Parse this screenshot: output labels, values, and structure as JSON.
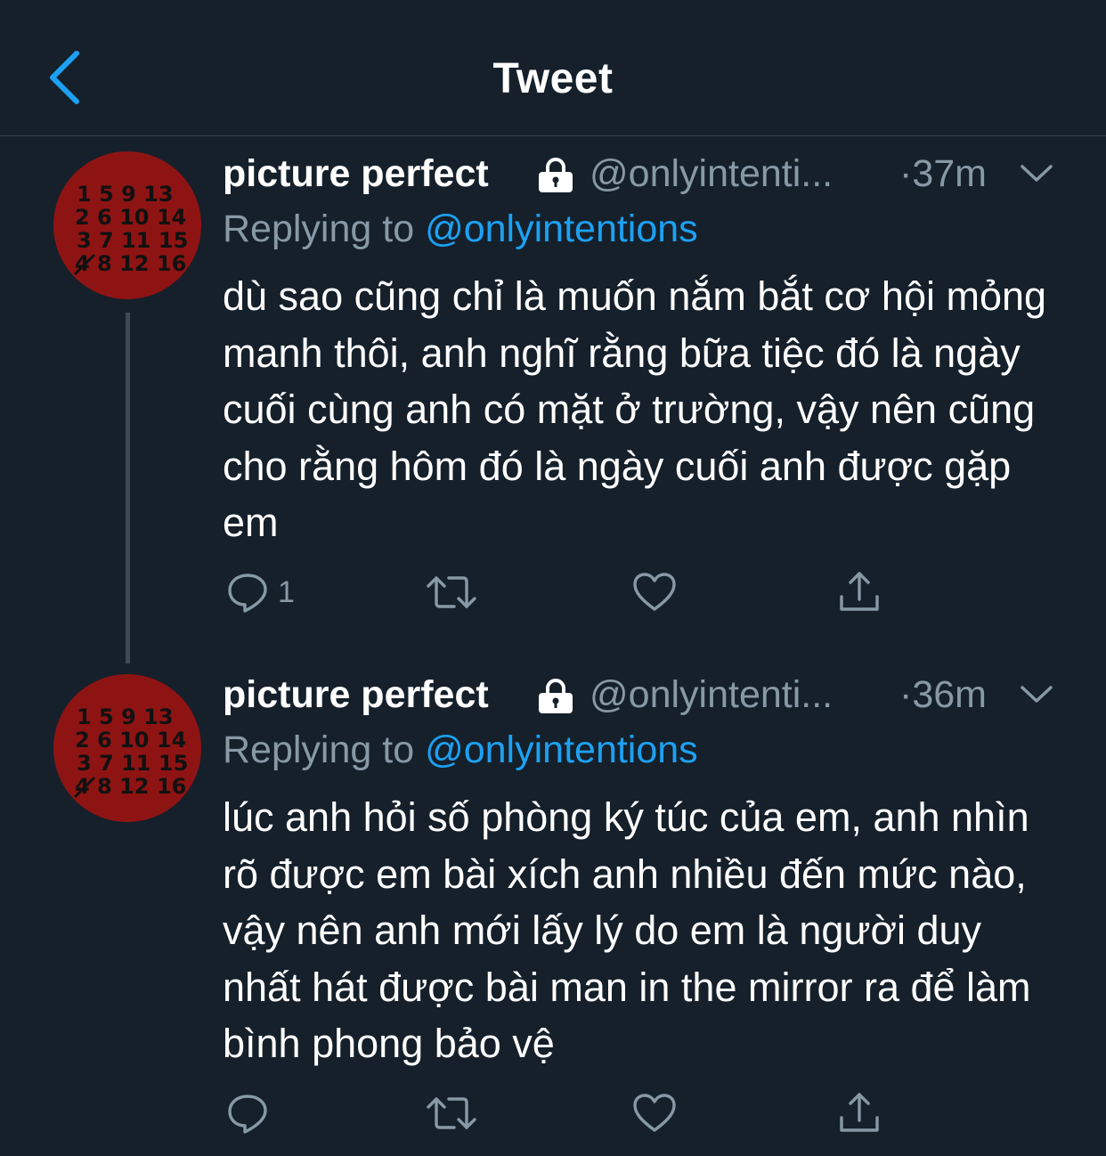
{
  "header": {
    "title": "Tweet",
    "back_icon": "chevron-left-icon"
  },
  "colors": {
    "background": "#15202b",
    "accent": "#1da1f2",
    "secondary_text": "#8899a6",
    "divider": "#38444d",
    "avatar_red": "#8e1413"
  },
  "tweets": [
    {
      "display_name": "picture perfect",
      "handle": "@onlyintenti...",
      "time": "·37m",
      "replying_prefix": "Replying to ",
      "replying_to": "@onlyintentions",
      "text": "dù sao cũng chỉ là muốn nắm bắt cơ hội mỏng manh thôi, anh nghĩ rằng bữa tiệc đó là ngày cuối cùng anh có mặt ở trường, vậy nên cũng cho rằng hôm đó là ngày cuối anh được gặp em",
      "reply_count": "1",
      "avatar": {
        "rows": [
          "1 5 9 13",
          "2 6 10 14",
          "3 7 11 15",
          "4 8 12 16"
        ]
      }
    },
    {
      "display_name": "picture perfect",
      "handle": "@onlyintenti...",
      "time": "·36m",
      "replying_prefix": "Replying to ",
      "replying_to": "@onlyintentions",
      "text": "lúc anh hỏi số phòng ký túc của em, anh nhìn rõ được em bài xích anh nhiều đến mức nào, vậy nên anh mới lấy lý do em là người duy nhất hát được bài man in the mirror ra để làm bình phong bảo vệ",
      "reply_count": "",
      "avatar": {
        "rows": [
          "1 5 9 13",
          "2 6 10 14",
          "3 7 11 15",
          "4 8 12 16"
        ]
      }
    }
  ]
}
